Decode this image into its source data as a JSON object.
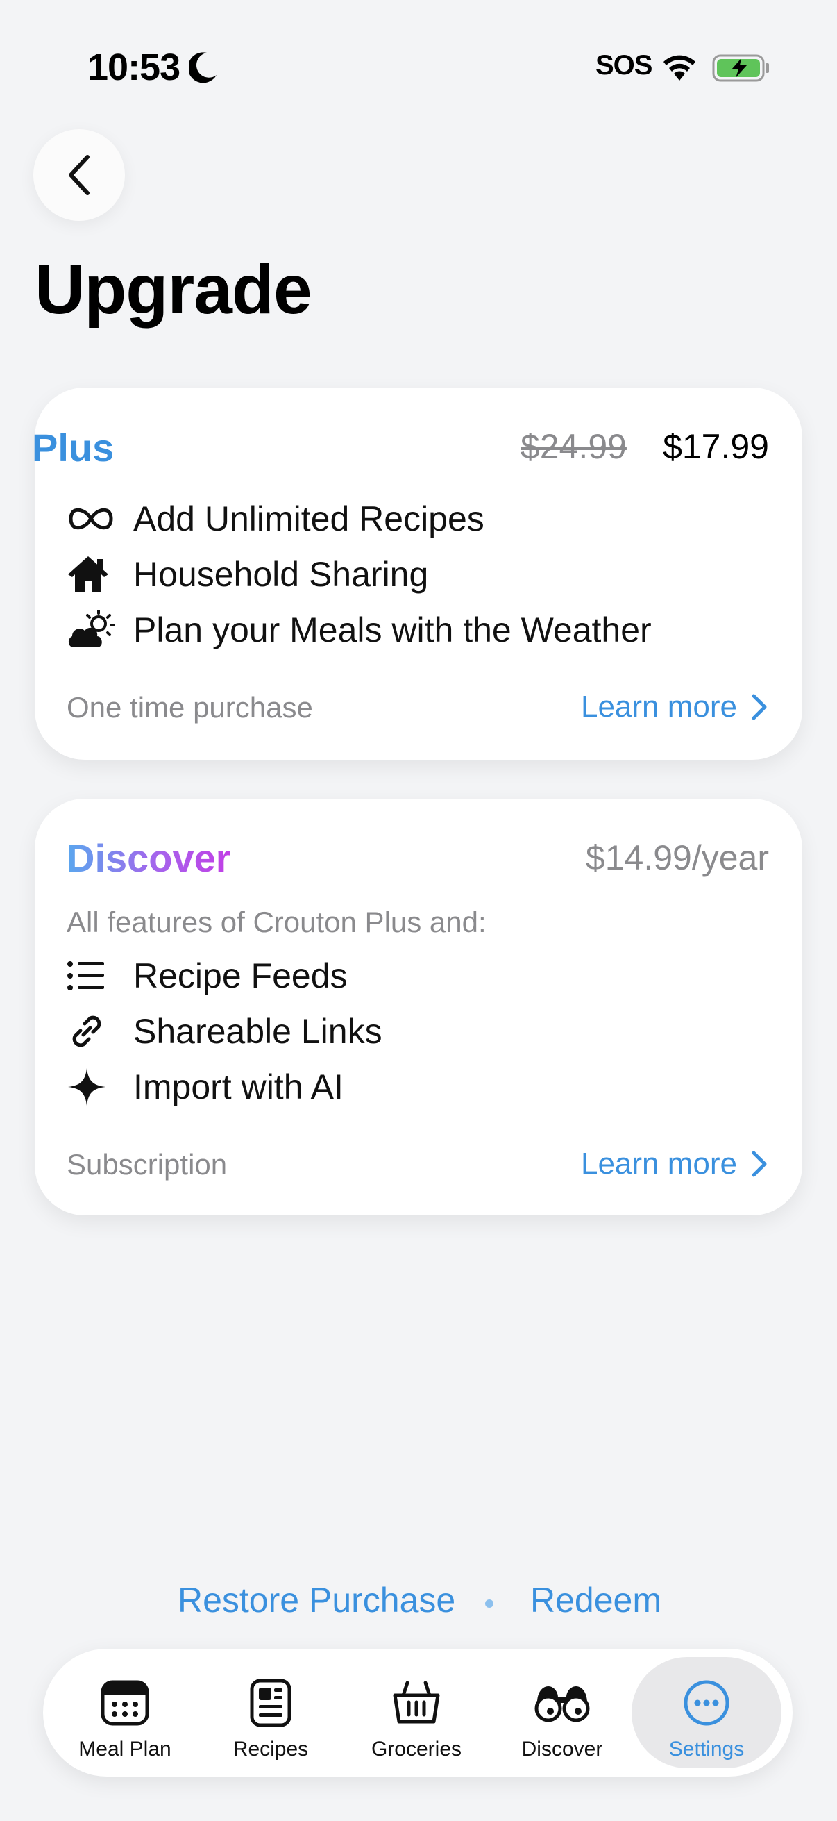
{
  "status_bar": {
    "time": "10:53",
    "carrier": "SOS",
    "icons": [
      "moon-icon",
      "wifi-icon",
      "battery-charging-icon"
    ]
  },
  "header": {
    "back_icon": "chevron-left-icon",
    "title": "Upgrade"
  },
  "plus": {
    "name": "Plus",
    "old_price": "$24.99",
    "price": "$17.99",
    "features": [
      {
        "icon": "infinity-icon",
        "label": "Add Unlimited Recipes"
      },
      {
        "icon": "house-icon",
        "label": "Household Sharing"
      },
      {
        "icon": "cloud-sun-icon",
        "label": "Plan your Meals with the Weather"
      }
    ],
    "purchase_type": "One time purchase",
    "learn_more": "Learn more"
  },
  "discover": {
    "name": "Discover",
    "price": "$14.99/year",
    "intro": "All features of Crouton Plus and:",
    "features": [
      {
        "icon": "list-icon",
        "label": "Recipe Feeds"
      },
      {
        "icon": "link-icon",
        "label": "Shareable Links"
      },
      {
        "icon": "sparkle-icon",
        "label": "Import with AI"
      }
    ],
    "purchase_type": "Subscription",
    "learn_more": "Learn more"
  },
  "footer_links": {
    "restore": "Restore Purchase",
    "redeem": "Redeem"
  },
  "tab_bar": {
    "tabs": [
      {
        "label": "Meal Plan",
        "icon": "calendar-icon",
        "active": false
      },
      {
        "label": "Recipes",
        "icon": "recipe-card-icon",
        "active": false
      },
      {
        "label": "Groceries",
        "icon": "basket-icon",
        "active": false
      },
      {
        "label": "Discover",
        "icon": "binoculars-icon",
        "active": false
      },
      {
        "label": "Settings",
        "icon": "ellipsis-circle-icon",
        "active": true
      }
    ]
  },
  "colors": {
    "accent": "#3a90de",
    "background": "#f3f4f6",
    "muted_text": "#8a8a8d",
    "discover_gradient": [
      "#5aa7ee",
      "#a564ec",
      "#c23ee6"
    ]
  }
}
